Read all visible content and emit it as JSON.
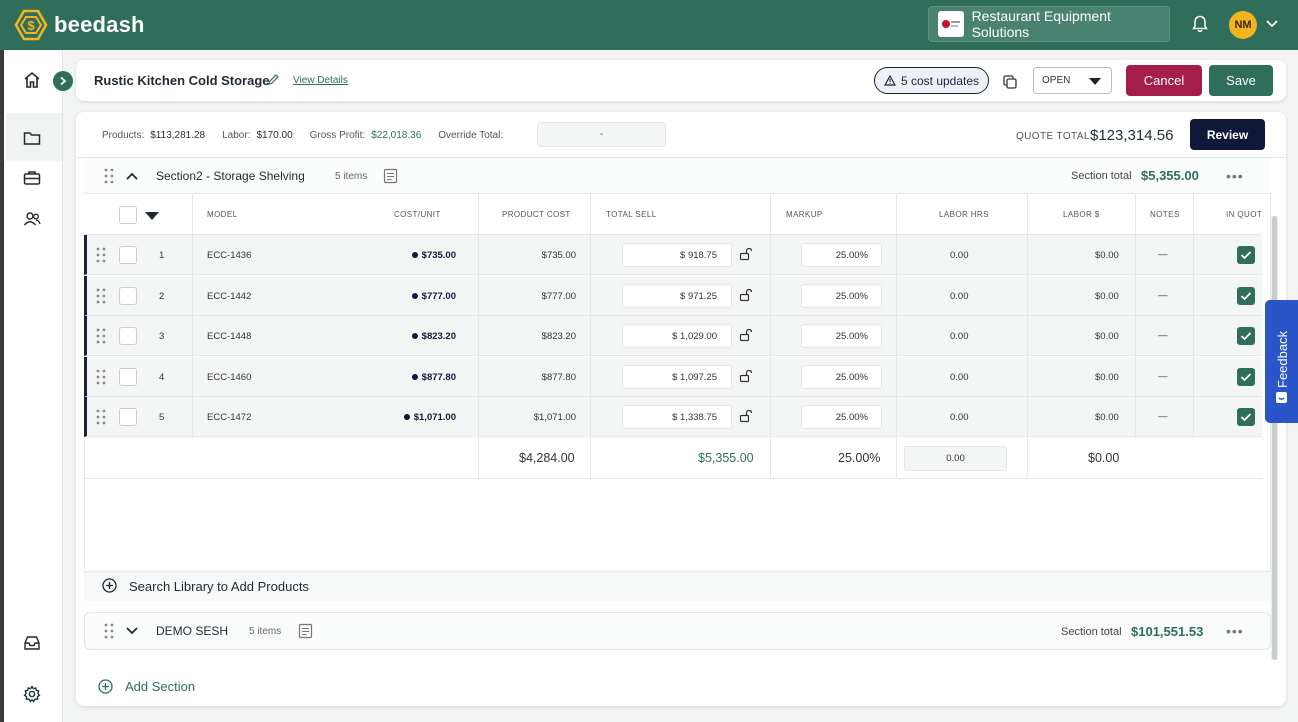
{
  "app": {
    "name": "beedash"
  },
  "topbar": {
    "company": "Restaurant Equipment Solutions",
    "user_initials": "NM"
  },
  "quote": {
    "title": "Rustic Kitchen Cold Storage",
    "view_details": "View Details",
    "cost_updates": "5 cost updates",
    "status": "OPEN",
    "cancel": "Cancel",
    "save": "Save"
  },
  "summary": {
    "products_label": "Products:",
    "products": "$113,281.28",
    "labor_label": "Labor:",
    "labor": "$170.00",
    "gross_profit_label": "Gross Profit:",
    "gross_profit": "$22,018.36",
    "override_label": "Override Total:",
    "override_value": "-",
    "quote_total_label": "QUOTE TOTAL",
    "quote_total": "$123,314.56",
    "review": "Review"
  },
  "section1": {
    "name": "Section2 - Storage Shelving",
    "items": "5 items",
    "total_label": "Section total",
    "total": "$5,355.00",
    "more": "•••",
    "columns": {
      "model": "MODEL",
      "cost_unit": "COST/UNIT",
      "product_cost": "PRODUCT COST",
      "total_sell": "TOTAL SELL",
      "markup": "MARKUP",
      "labor_hrs": "LABOR HRS",
      "labor_dollars": "LABOR $",
      "notes": "NOTES",
      "in_quote": "IN QUOT"
    },
    "rows": [
      {
        "num": "1",
        "model": "ECC-1436",
        "cost_unit": "$735.00",
        "product_cost": "$735.00",
        "total_sell": "$ 918.75",
        "markup": "25.00%",
        "labor_hrs": "0.00",
        "labor_dollars": "$0.00",
        "notes": "—"
      },
      {
        "num": "2",
        "model": "ECC-1442",
        "cost_unit": "$777.00",
        "product_cost": "$777.00",
        "total_sell": "$ 971.25",
        "markup": "25.00%",
        "labor_hrs": "0.00",
        "labor_dollars": "$0.00",
        "notes": "—"
      },
      {
        "num": "3",
        "model": "ECC-1448",
        "cost_unit": "$823.20",
        "product_cost": "$823.20",
        "total_sell": "$ 1,029.00",
        "markup": "25.00%",
        "labor_hrs": "0.00",
        "labor_dollars": "$0.00",
        "notes": "—"
      },
      {
        "num": "4",
        "model": "ECC-1460",
        "cost_unit": "$877.80",
        "product_cost": "$877.80",
        "total_sell": "$ 1,097.25",
        "markup": "25.00%",
        "labor_hrs": "0.00",
        "labor_dollars": "$0.00",
        "notes": "—"
      },
      {
        "num": "5",
        "model": "ECC-1472",
        "cost_unit": "$1,071.00",
        "product_cost": "$1,071.00",
        "total_sell": "$ 1,338.75",
        "markup": "25.00%",
        "labor_hrs": "0.00",
        "labor_dollars": "$0.00",
        "notes": "—"
      }
    ],
    "totals": {
      "product_cost": "$4,284.00",
      "total_sell": "$5,355.00",
      "markup": "25.00%",
      "labor_hrs": "0.00",
      "labor_dollars": "$0.00"
    },
    "search_library": "Search Library to Add Products"
  },
  "section2": {
    "name": "DEMO SESH",
    "items": "5 items",
    "total_label": "Section total",
    "total": "$101,551.53",
    "more": "•••"
  },
  "add_section": "Add Section",
  "feedback": "Feedback",
  "colors": {
    "brand_green": "#2f6e5b",
    "cancel": "#a51d4b",
    "navy": "#0f1838",
    "feedback": "#2a55c8"
  }
}
